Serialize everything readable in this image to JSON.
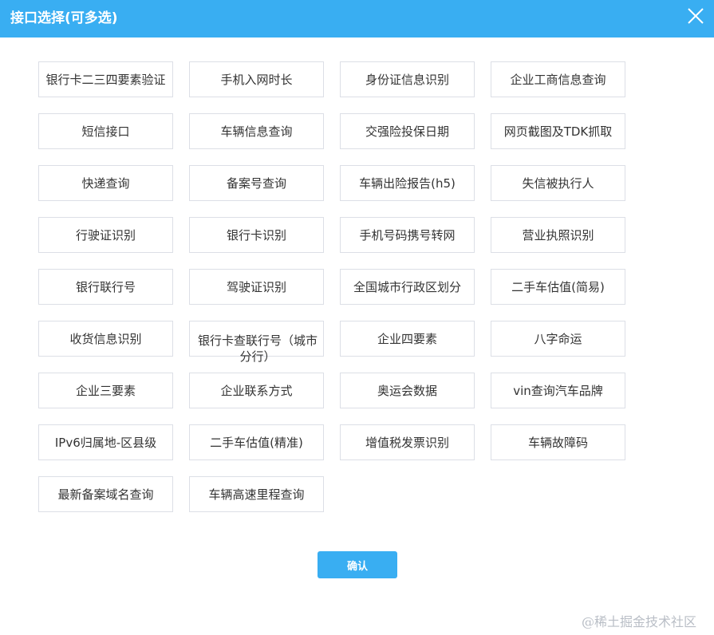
{
  "dialog": {
    "title": "接口选择(可多选)",
    "close_icon": "close-icon",
    "confirm_label": "确认"
  },
  "options": [
    "银行卡二三四要素验证",
    "手机入网时长",
    "身份证信息识别",
    "企业工商信息查询",
    "短信接口",
    "车辆信息查询",
    "交强险投保日期",
    "网页截图及TDK抓取",
    "快递查询",
    "备案号查询",
    "车辆出险报告(h5)",
    "失信被执行人",
    "行驶证识别",
    "银行卡识别",
    "手机号码携号转网",
    "营业执照识别",
    "银行联行号",
    "驾驶证识别",
    "全国城市行政区划分",
    "二手车估值(简易)",
    "收货信息识别",
    "银行卡查联行号（城市分行）",
    "企业四要素",
    "八字命运",
    "企业三要素",
    "企业联系方式",
    "奥运会数据",
    "vin查询汽车品牌",
    "IPv6归属地-区县级",
    "二手车估值(精准)",
    "增值税发票识别",
    "车辆故障码",
    "最新备案域名查询",
    "车辆高速里程查询"
  ],
  "watermark": "@稀土掘金技术社区",
  "colors": {
    "accent": "#39aef2",
    "border": "#dcdfe6",
    "text": "#333333"
  }
}
